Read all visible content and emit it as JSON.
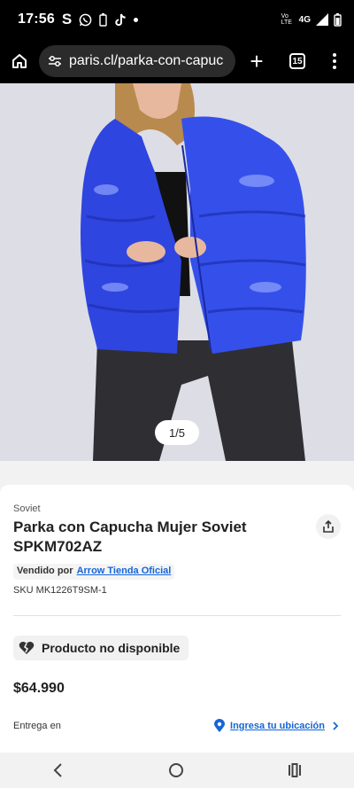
{
  "status": {
    "time": "17:56",
    "net_text": "Vo LTE",
    "network_type": "4G",
    "icons": [
      "s-icon",
      "whatsapp-icon",
      "battery-saver-icon",
      "tiktok-icon",
      "dot-icon",
      "signal-icon",
      "battery-icon"
    ]
  },
  "browser": {
    "url": "paris.cl/parka-con-capuc",
    "tab_count": "15",
    "home_icon": "home-icon",
    "new_tab_icon": "plus-icon",
    "menu_icon": "more-vertical-icon"
  },
  "gallery": {
    "counter": "1/5"
  },
  "product": {
    "brand": "Soviet",
    "title": "Parka con Capucha Mujer Soviet SPKM702AZ",
    "sold_by_label": "Vendido por",
    "seller_name": "Arrow Tienda Oficial",
    "sku": "SKU MK1226T9SM-1",
    "availability": "Producto no disponible",
    "price": "$64.990",
    "delivery_label": "Entrega en",
    "location_cta": "Ingresa tu ubicación",
    "colors": {
      "jacket": "#2f45e0",
      "link": "#1565d8"
    }
  },
  "system_nav": {
    "icons": [
      "back-icon",
      "home-circle-icon",
      "recents-icon"
    ]
  }
}
